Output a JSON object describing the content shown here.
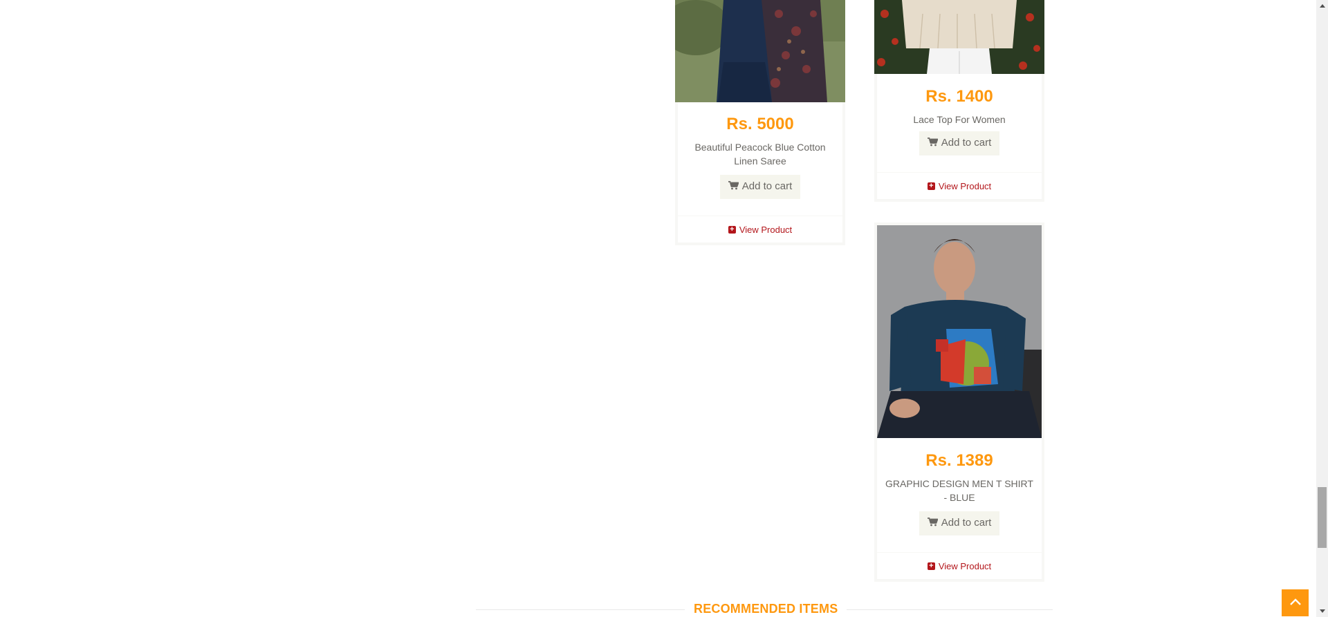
{
  "products": [
    {
      "price": "Rs. 5000",
      "name": "Beautiful Peacock Blue Cotton Linen Saree",
      "add_to_cart": "Add to cart",
      "view_product": "View Product",
      "image": "saree-photo"
    },
    {
      "price": "Rs. 1400",
      "name": "Lace Top For Women",
      "add_to_cart": "Add to cart",
      "view_product": "View Product",
      "image": "lace-top-photo"
    },
    {
      "price": "Rs. 1389",
      "name": "GRAPHIC DESIGN MEN T SHIRT - BLUE",
      "add_to_cart": "Add to cart",
      "view_product": "View Product",
      "image": "graphic-tshirt-photo"
    }
  ],
  "recommended": {
    "title": "RECOMMENDED ITEMS"
  },
  "icons": {
    "cart": "shopping-cart-icon",
    "view": "plus-square-icon",
    "scroll_top": "chevron-up-icon"
  },
  "colors": {
    "accent": "#fe980f",
    "link": "#b3161b",
    "button_bg": "#f5f5ed",
    "text": "#696763"
  }
}
